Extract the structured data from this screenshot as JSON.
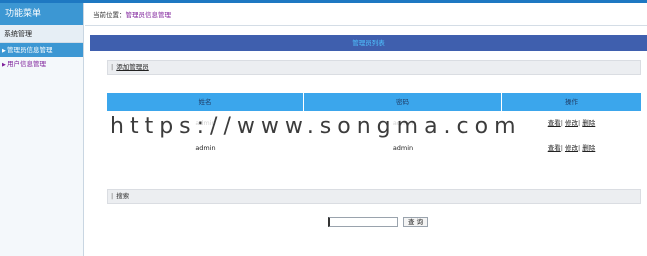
{
  "sidebar": {
    "title": "功能菜单",
    "section": "系统管理",
    "items": [
      {
        "label": "管理员信息管理",
        "active": true
      },
      {
        "label": "用户信息管理",
        "active": false
      }
    ]
  },
  "breadcrumb": {
    "prefix": "当前位置：",
    "current": "管理员信息管理"
  },
  "header_bar": {
    "title": "管理员列表"
  },
  "toolbar": {
    "add_label": "添加管理员"
  },
  "table": {
    "columns": [
      "姓名",
      "密码",
      "操作"
    ],
    "rows": [
      {
        "name": "admin",
        "password": "admin",
        "ops": [
          "查看",
          "修改",
          "删除"
        ]
      },
      {
        "name": "admin",
        "password": "admin",
        "ops": [
          "查看",
          "修改",
          "删除"
        ]
      }
    ]
  },
  "watermark": {
    "text": "https://www.songma.com"
  },
  "search": {
    "label": "搜索",
    "input_value": "",
    "button_label": "查 询"
  },
  "colors": {
    "accent": "#3c97d3",
    "header_bar": "#3f5fae",
    "table_head": "#3ba6ec",
    "link": "#7d1e9a"
  }
}
